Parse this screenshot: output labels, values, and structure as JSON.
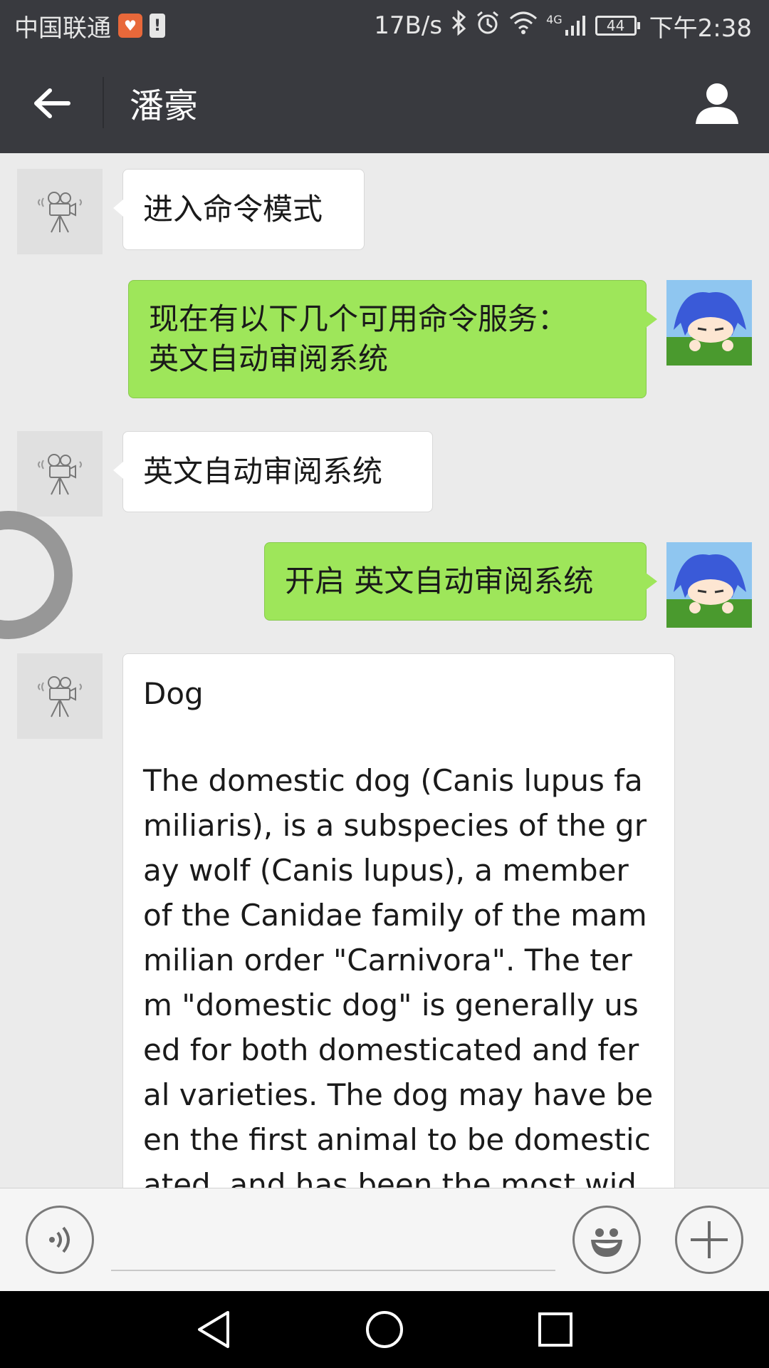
{
  "status_bar": {
    "carrier": "中国联通",
    "network_speed": "17B/s",
    "network_type": "4G",
    "battery": "44",
    "time": "下午2:38"
  },
  "header": {
    "title": "潘豪"
  },
  "messages": [
    {
      "direction": "in",
      "text": "进入命令模式"
    },
    {
      "direction": "out",
      "text": "现在有以下几个可用命令服务：\n英文自动审阅系统"
    },
    {
      "direction": "in",
      "text": "英文自动审阅系统"
    },
    {
      "direction": "out",
      "text": "开启 英文自动审阅系统"
    },
    {
      "direction": "in",
      "title": "Dog",
      "body": "The domestic dog (Canis lupus familiaris), is a subspecies of the gray wolf (Canis lupus), a member of the Canidae family of the mammilian order \"Carnivora\". The term \"domestic dog\" is generally used for both domesticated and feral varieties. The dog may have been the first animal to be domesticated, and has been the most widely"
    }
  ],
  "input_bar": {
    "placeholder": ""
  },
  "colors": {
    "bar_dark": "#393a3f",
    "chat_bg": "#ebebeb",
    "bubble_out": "#9ee65a",
    "bubble_in": "#ffffff"
  },
  "icons": {
    "back": "arrow-left-icon",
    "profile": "person-icon",
    "bot_avatar": "camera-tripod-icon",
    "voice": "voice-icon",
    "emoji": "smiley-icon",
    "more": "plus-icon",
    "nav_back": "triangle-back-icon",
    "nav_home": "circle-home-icon",
    "nav_recents": "square-recents-icon"
  }
}
